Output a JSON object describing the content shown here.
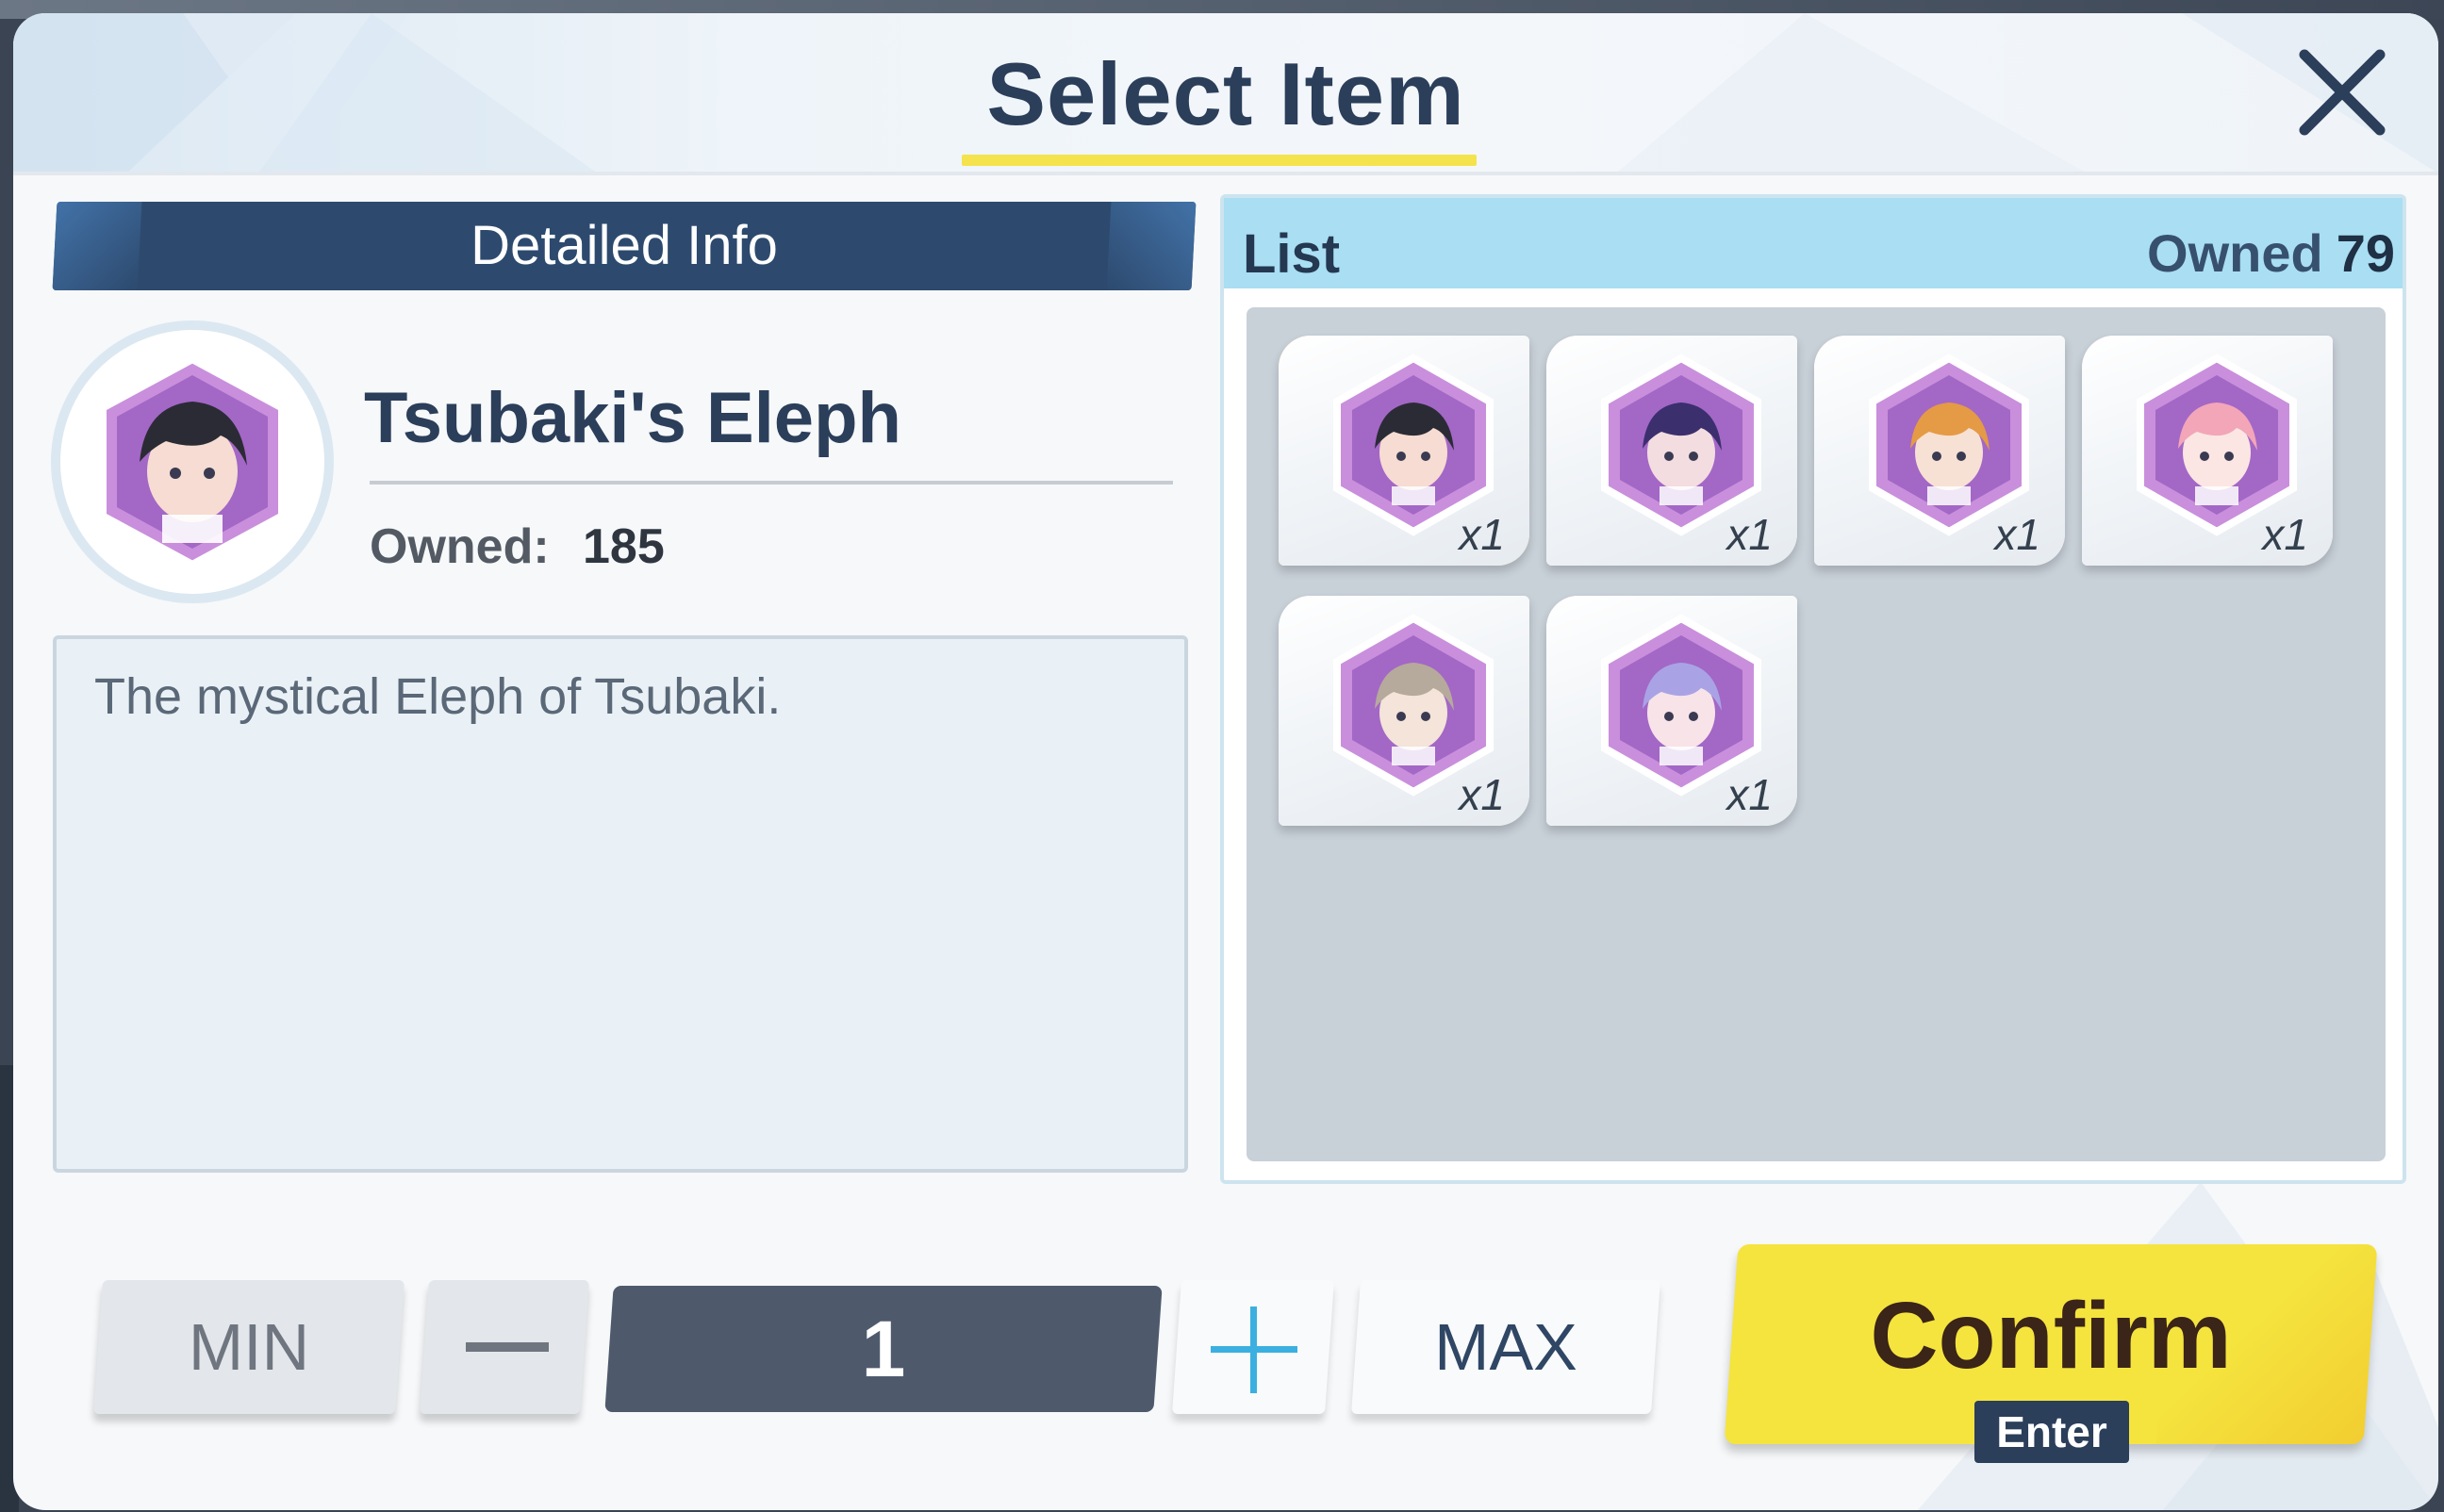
{
  "dialog": {
    "title": "Select Item",
    "close_icon": "close-icon"
  },
  "detail": {
    "banner_label": "Detailed Info",
    "item_name": "Tsubaki's Eleph",
    "owned_label": "Owned:",
    "owned_value": "185",
    "description": "The mystical Eleph of Tsubaki."
  },
  "list": {
    "title": "List",
    "owned_label": "Owned",
    "owned_count": "79",
    "items": [
      {
        "qty": "x1",
        "selected": true,
        "hair": "#2b2b35",
        "skin": "#f6dcd2"
      },
      {
        "qty": "x1",
        "selected": false,
        "hair": "#3b2f6e",
        "skin": "#f3dde0"
      },
      {
        "qty": "x1",
        "selected": false,
        "hair": "#e59a45",
        "skin": "#f7e1d4"
      },
      {
        "qty": "x1",
        "selected": false,
        "hair": "#f2a6b8",
        "skin": "#fbe6e3"
      },
      {
        "qty": "x1",
        "selected": false,
        "hair": "#b6aa9c",
        "skin": "#f4e4d9"
      },
      {
        "qty": "x1",
        "selected": false,
        "hair": "#a9a3e6",
        "skin": "#f8e3e8"
      }
    ]
  },
  "controls": {
    "min_label": "MIN",
    "minus_icon": "minus-icon",
    "quantity": "1",
    "plus_icon": "plus-icon",
    "max_label": "MAX",
    "confirm_label": "Confirm",
    "enter_label": "Enter"
  },
  "colors": {
    "title": "#2b3e5a",
    "accent_yellow": "#f5e43e",
    "list_header": "#a9def3",
    "plus_blue": "#3bb0e0"
  }
}
